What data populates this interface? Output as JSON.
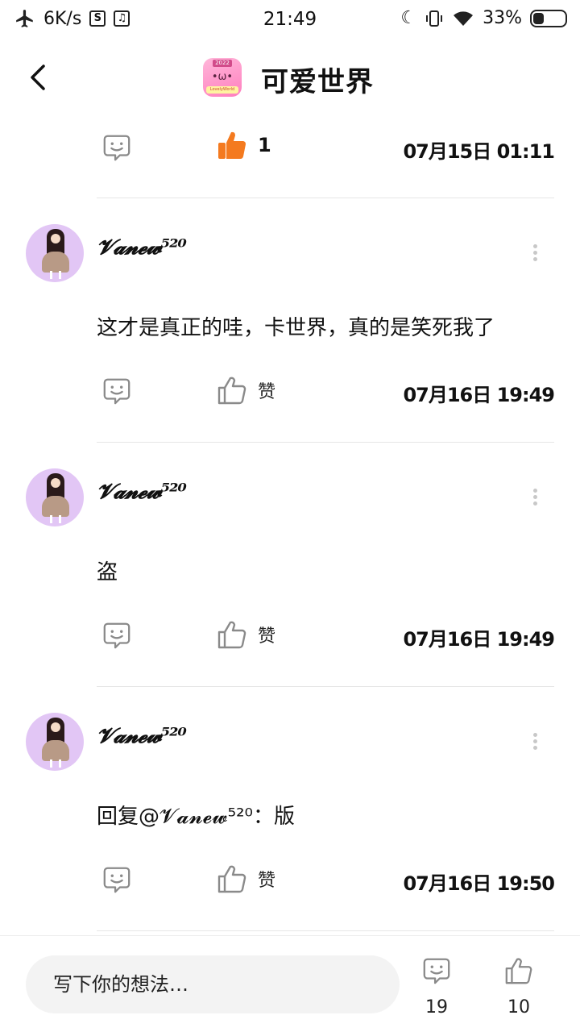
{
  "status_bar": {
    "speed": "6K/s",
    "time": "21:49",
    "battery": "33%",
    "battery_level": 0.33
  },
  "header": {
    "title": "可爱世界",
    "logo_year": "2022",
    "logo_face": "•ω•",
    "logo_band": "LovelyWorld"
  },
  "post_actions": {
    "like_count": "1",
    "timestamp": "07月15日 01:11"
  },
  "comments": [
    {
      "username": "𝓥𝓪𝓷𝓮𝔀⁵²⁰",
      "text": "这才是真正的哇，卡世界，真的是笑死我了",
      "like_label": "赞",
      "timestamp": "07月16日 19:49"
    },
    {
      "username": "𝓥𝓪𝓷𝓮𝔀⁵²⁰",
      "text": "盗",
      "like_label": "赞",
      "timestamp": "07月16日 19:49"
    },
    {
      "username": "𝓥𝓪𝓷𝓮𝔀⁵²⁰",
      "text": "回复@𝓥𝓪𝓷𝓮𝔀⁵²⁰：版",
      "like_label": "赞",
      "timestamp": "07月16日 19:50"
    }
  ],
  "bottom_bar": {
    "placeholder": "写下你的想法…",
    "comment_count": "19",
    "like_count": "10"
  },
  "colors": {
    "accent_like": "#f47a1f",
    "avatar_bg": "#e2c6f5"
  }
}
